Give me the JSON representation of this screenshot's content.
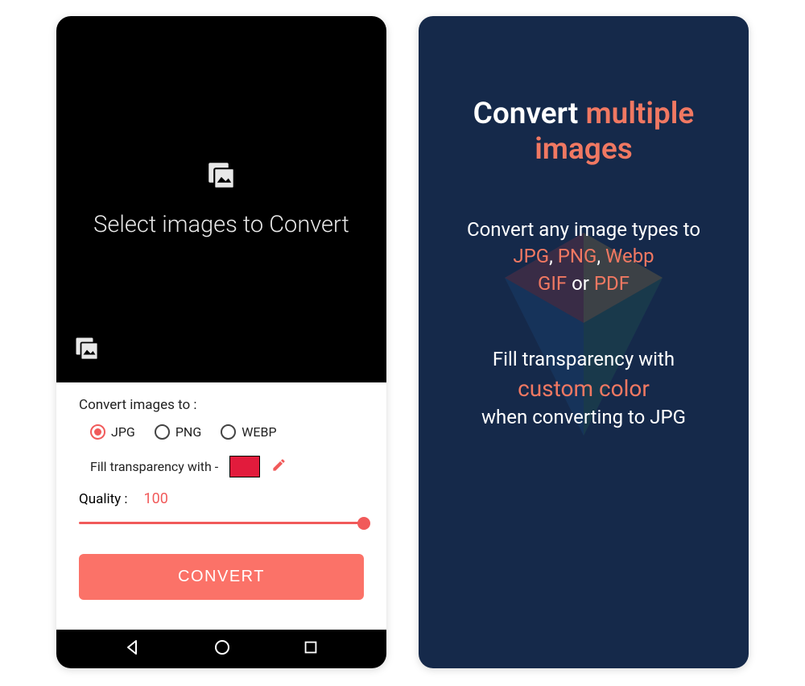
{
  "left": {
    "dropzone_text": "Select images to Convert",
    "convert_to_label": "Convert images to :",
    "formats": {
      "jpg": "JPG",
      "png": "PNG",
      "webp": "WEBP"
    },
    "fill_label": "Fill transparency with -",
    "fill_color": "#e21b3c",
    "quality_label": "Quality :",
    "quality_value": "100",
    "convert_button": "CONVERT",
    "selected_format": "jpg"
  },
  "right": {
    "headline_1": "Convert ",
    "headline_2": "multiple images",
    "sub_line1": "Convert any image types to",
    "fmt_jpg": "JPG",
    "fmt_png": "PNG",
    "fmt_webp": "Webp",
    "fmt_gif": "GIF",
    "fmt_or": " or ",
    "fmt_pdf": "PDF",
    "sep": ", ",
    "tag_line1": "Fill transparency with",
    "tag_line2": "custom color",
    "tag_line3": "when converting to JPG"
  }
}
